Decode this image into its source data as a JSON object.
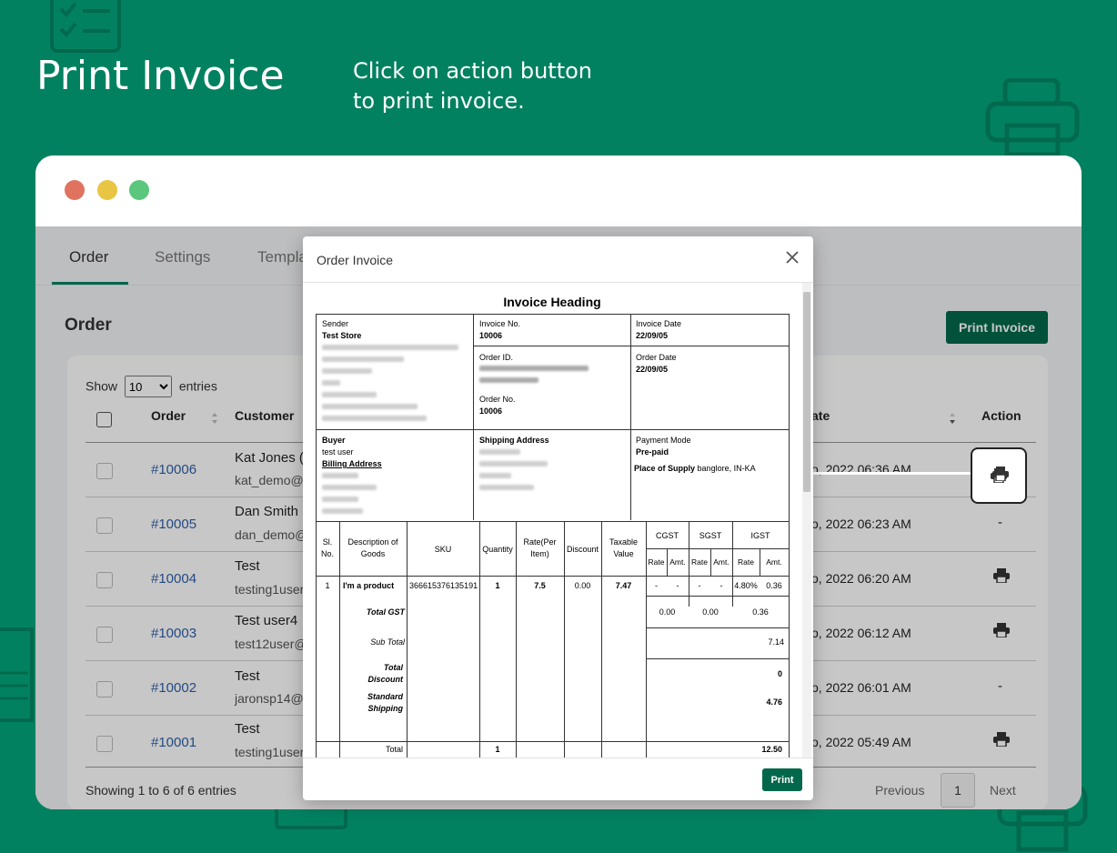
{
  "hero": {
    "title": "Print Invoice",
    "subtitle_line1": "Click on action button",
    "subtitle_line2": "to print invoice."
  },
  "colors": {
    "background": "#028160",
    "accent": "#03684b",
    "link": "#2f5fa8"
  },
  "tabs": [
    {
      "label": "Order"
    },
    {
      "label": "Settings"
    },
    {
      "label": "Templa"
    }
  ],
  "page": {
    "title": "Order",
    "print_invoice_label": "Print Invoice"
  },
  "table": {
    "show_label": "Show",
    "entries_value": "10",
    "entries_label": "entries",
    "columns": {
      "order": "Order",
      "customer": "Customer",
      "date": "ate",
      "action": "Action"
    },
    "rows": [
      {
        "order": "#10006",
        "name": "Kat Jones (D",
        "email": "kat_demo@",
        "date": "o, 2022 06:36 AM",
        "action": "print-icon"
      },
      {
        "order": "#10005",
        "name": "Dan Smith (I",
        "email": "dan_demo@",
        "date": "o, 2022 06:23 AM",
        "action": "-"
      },
      {
        "order": "#10004",
        "name": "Test",
        "email": "testing1user",
        "date": "o, 2022 06:20 AM",
        "action": "print-icon"
      },
      {
        "order": "#10003",
        "name": "Test user4",
        "email": "test12user@",
        "date": "o, 2022 06:12 AM",
        "action": "print-icon"
      },
      {
        "order": "#10002",
        "name": "Test",
        "email": "jaronsp14@",
        "date": "o, 2022 06:01 AM",
        "action": "-"
      },
      {
        "order": "#10001",
        "name": "Test",
        "email": "testing1user",
        "date": "o, 2022 05:49 AM",
        "action": "print-icon"
      }
    ],
    "footer": "Showing 1 to 6 of 6 entries",
    "previous": "Previous",
    "page": "1",
    "next": "Next"
  },
  "modal": {
    "title": "Order Invoice",
    "print_label": "Print",
    "invoice": {
      "heading": "Invoice Heading",
      "sender_label": "Sender",
      "sender_name": "Test Store",
      "invoice_no_label": "Invoice No.",
      "invoice_no": "10006",
      "invoice_date_label": "Invoice Date",
      "invoice_date": "22/09/05",
      "order_id_label": "Order ID.",
      "order_no_label": "Order No.",
      "order_no": "10006",
      "order_date_label": "Order Date",
      "order_date": "22/09/05",
      "buyer_label": "Buyer",
      "buyer_name": "test user",
      "billing_label": "Billing Address",
      "shipping_label": "Shipping Address",
      "payment_mode_label": "Payment Mode",
      "payment_mode": "Pre-paid",
      "supply_label": "Place of Supply",
      "supply_value": "banglore, IN-KA",
      "headers": {
        "sl1": "Sl.",
        "sl2": "No.",
        "desc1": "Description of",
        "desc2": "Goods",
        "sku": "SKU",
        "qty": "Quantity",
        "rate1": "Rate(Per",
        "rate2": "Item)",
        "discount": "Discount",
        "taxable1": "Taxable",
        "taxable2": "Value",
        "cgst": "CGST",
        "sgst": "SGST",
        "igst": "IGST",
        "rate": "Rate",
        "amt": "Amt."
      },
      "item": {
        "sl": "1",
        "desc": "I'm a product",
        "sku": "366615376135191",
        "qty": "1",
        "rate": "7.5",
        "discount": "0.00",
        "taxable": "7.47",
        "cgst_rate": "-",
        "cgst_amt": "-",
        "sgst_rate": "-",
        "sgst_amt": "-",
        "igst_rate": "4.80%",
        "igst_amt": "0.36"
      },
      "total_gst_label": "Total GST",
      "total_gst_cgst": "0.00",
      "total_gst_sgst": "0.00",
      "total_gst_igst": "0.36",
      "subtotal_label": "Sub Total",
      "subtotal": "7.14",
      "total_discount_label1": "Total",
      "total_discount_label2": "Discount",
      "total_discount": "0",
      "shipping_label1": "Standard",
      "shipping_label2": "Shipping",
      "shipping": "4.76",
      "total_label": "Total",
      "total_qty": "1",
      "total": "12.50"
    }
  }
}
